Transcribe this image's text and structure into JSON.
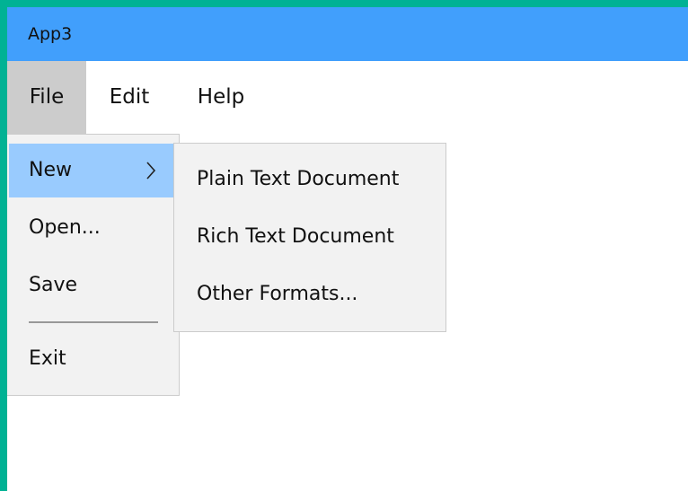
{
  "window": {
    "title": "App3"
  },
  "menubar": {
    "items": [
      {
        "label": "File"
      },
      {
        "label": "Edit"
      },
      {
        "label": "Help"
      }
    ]
  },
  "file_menu": {
    "items": [
      {
        "label": "New",
        "has_submenu": true,
        "highlighted": true
      },
      {
        "label": "Open..."
      },
      {
        "label": "Save"
      },
      {
        "label": "Exit"
      }
    ]
  },
  "new_submenu": {
    "items": [
      {
        "label": "Plain Text Document"
      },
      {
        "label": "Rich Text Document"
      },
      {
        "label": "Other Formats..."
      }
    ]
  },
  "colors": {
    "desktop_background": "#00b294",
    "titlebar": "#419ffc",
    "menu_active": "#cccccc",
    "menu_highlight": "#99cbfe",
    "menu_background": "#f2f2f2"
  },
  "icons": {
    "submenu_arrow": "chevron-right-icon"
  }
}
